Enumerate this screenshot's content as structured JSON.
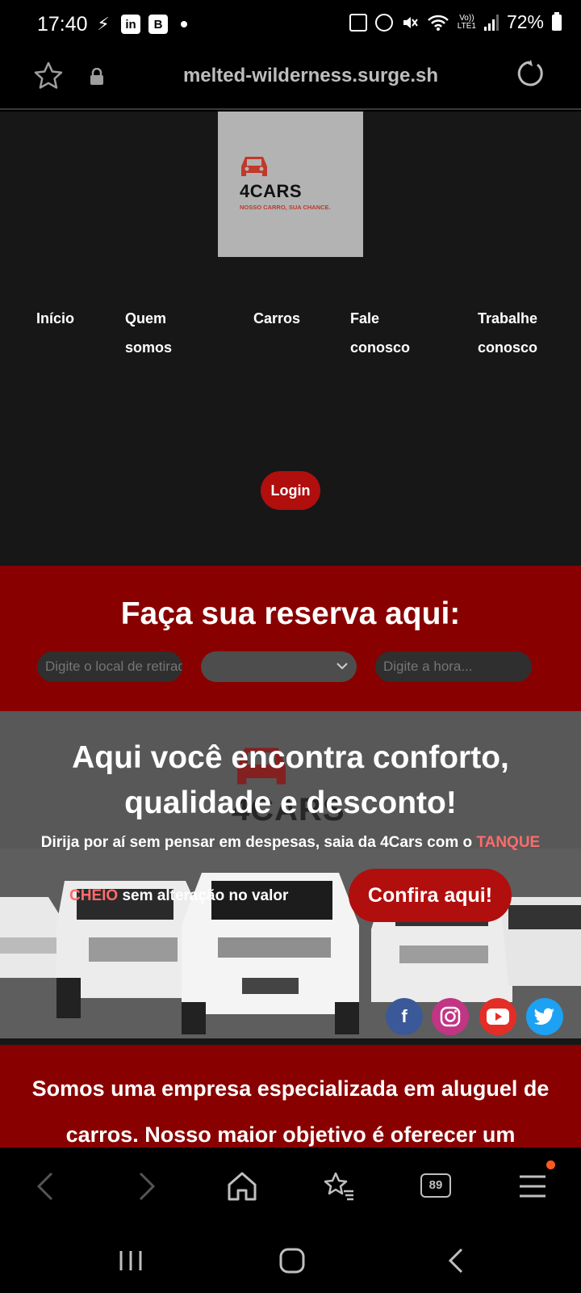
{
  "status_bar": {
    "time": "17:40",
    "left_icons": [
      "flash-app-icon",
      "linkedin-icon",
      "b-app-icon"
    ],
    "right_icons": [
      "recycle-icon",
      "alarm-icon",
      "mute-icon",
      "wifi-icon",
      "volte-icon",
      "signal-icon"
    ],
    "network_label_top": "Vo))",
    "network_label_bottom": "LTE1",
    "battery_percent": "72%",
    "battery_level": 0.72
  },
  "browser": {
    "url": "melted-wilderness.surge.sh",
    "tab_count": "89"
  },
  "site": {
    "logo": {
      "name": "4CARS",
      "tagline": "NOSSO CARRO, SUA CHANCE."
    },
    "nav": [
      {
        "label_line1": "Início",
        "label_line2": ""
      },
      {
        "label_line1": "Quem",
        "label_line2": "somos"
      },
      {
        "label_line1": "Carros",
        "label_line2": ""
      },
      {
        "label_line1": "Fale",
        "label_line2": "conosco"
      },
      {
        "label_line1": "Trabalhe",
        "label_line2": "conosco"
      }
    ],
    "login_label": "Login",
    "reservation": {
      "title": "Faça sua reserva aqui:",
      "location_placeholder": "Digite o local de retirada...",
      "date_value": "",
      "time_placeholder": "Digite a hora..."
    },
    "hero": {
      "title_line1": "Aqui você encontra conforto,",
      "title_line2": "qualidade e desconto!",
      "watermark": "4CARS",
      "text_part1": "Dirija por aí sem pensar em despesas, saia da 4Cars com o ",
      "text_highlight1": "TANQUE",
      "text_highlight2": "CHEIO",
      "text_part2": " sem alteração no valor",
      "cta_label": "Confira aqui!",
      "social": [
        "facebook-icon",
        "instagram-icon",
        "youtube-icon",
        "twitter-icon"
      ]
    },
    "about": {
      "text": "Somos uma empresa especializada em aluguel de carros. Nosso maior objetivo é oferecer um"
    }
  },
  "colors": {
    "header_bg": "#171717",
    "brand_red": "#b10e0e",
    "section_red": "#890000",
    "highlight": "#ff6b6b"
  }
}
